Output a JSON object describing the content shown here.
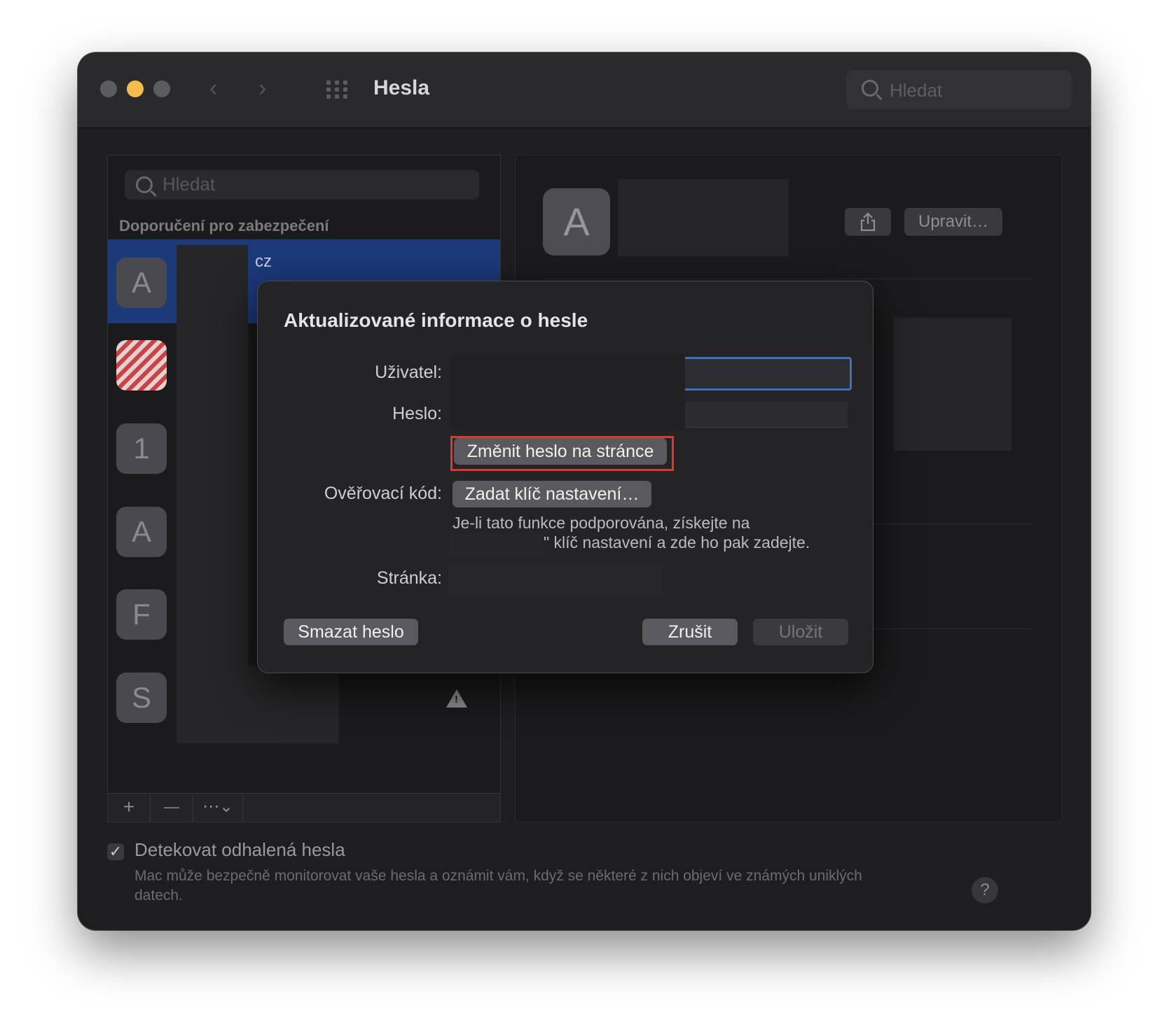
{
  "window": {
    "title": "Hesla",
    "search_placeholder": "Hledat"
  },
  "sidebar": {
    "search_placeholder": "Hledat",
    "section_header": "Doporučení pro zabezpečení",
    "selected_row_suffix": "cz",
    "items": [
      {
        "avatar": "A"
      },
      {
        "avatar": ""
      },
      {
        "avatar": "1"
      },
      {
        "avatar": "A"
      },
      {
        "avatar": "F"
      },
      {
        "avatar": "S"
      }
    ],
    "toolbar": {
      "add": "+",
      "remove": "—",
      "more": "⋯⌄"
    }
  },
  "detail": {
    "avatar": "A",
    "edit_button": "Upravit…"
  },
  "dialog": {
    "title": "Aktualizované informace o hesle",
    "user_label": "Uživatel:",
    "password_label": "Heslo:",
    "change_password_button": "Změnit heslo na stránce",
    "verification_label": "Ověřovací kód:",
    "setup_key_button": "Zadat klíč nastavení…",
    "note_line1": "Je-li tato funkce podporována, získejte na",
    "note_line2": "\" klíč nastavení a zde ho pak zadejte.",
    "site_label": "Stránka:",
    "delete_button": "Smazat heslo",
    "cancel_button": "Zrušit",
    "save_button": "Uložit"
  },
  "footer": {
    "checkbox_label": "Detekovat odhalená hesla",
    "checkbox_checked": true,
    "description": "Mac může bezpečně monitorovat vaše hesla a oznámit vám, když se některé z nich objeví ve známých uniklých datech.",
    "help": "?"
  },
  "colors": {
    "accent_blue": "#3d6fc2",
    "selection": "#1c3a7a",
    "highlight_red": "#e0392b",
    "traffic_yellow": "#f5bd4f"
  }
}
